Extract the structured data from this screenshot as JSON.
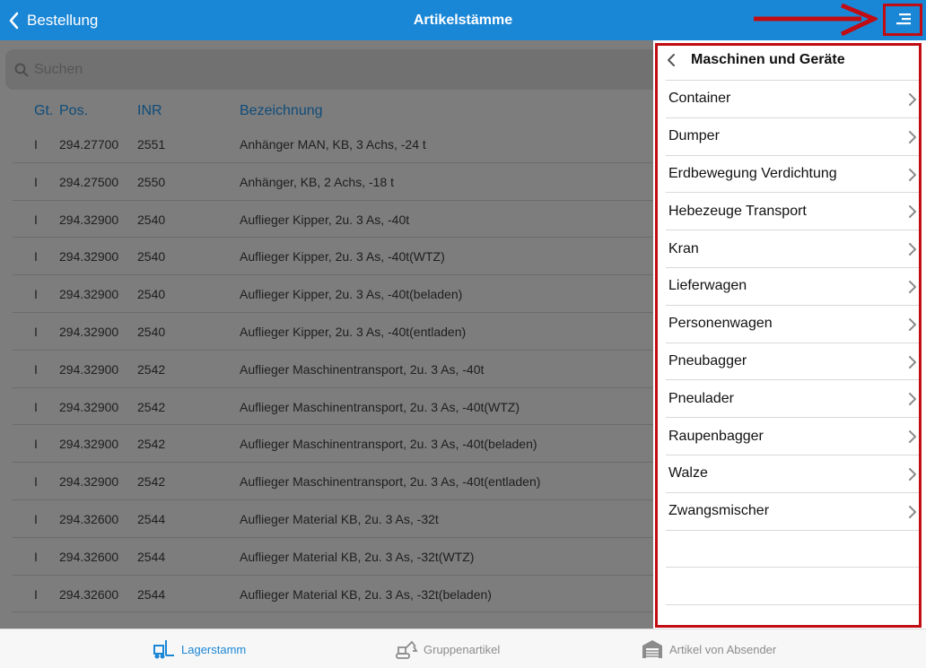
{
  "header": {
    "back_label": "Bestellung",
    "title": "Artikelstämme"
  },
  "search": {
    "placeholder": "Suchen"
  },
  "table": {
    "columns": [
      "Gt.",
      "Pos.",
      "INR",
      "Bezeichnung"
    ],
    "rows": [
      {
        "gt": "I",
        "pos": "294.27700",
        "inr": "2551",
        "bez": "Anhänger MAN, KB, 3 Achs, -24 t"
      },
      {
        "gt": "I",
        "pos": "294.27500",
        "inr": "2550",
        "bez": "Anhänger, KB, 2 Achs, -18 t"
      },
      {
        "gt": "I",
        "pos": "294.32900",
        "inr": "2540",
        "bez": "Auflieger Kipper, 2u. 3 As, -40t"
      },
      {
        "gt": "I",
        "pos": "294.32900",
        "inr": "2540",
        "bez": "Auflieger Kipper, 2u. 3 As, -40t(WTZ)"
      },
      {
        "gt": "I",
        "pos": "294.32900",
        "inr": "2540",
        "bez": "Auflieger Kipper, 2u. 3 As, -40t(beladen)"
      },
      {
        "gt": "I",
        "pos": "294.32900",
        "inr": "2540",
        "bez": "Auflieger Kipper, 2u. 3 As, -40t(entladen)"
      },
      {
        "gt": "I",
        "pos": "294.32900",
        "inr": "2542",
        "bez": "Auflieger Maschinentransport, 2u. 3 As, -40t"
      },
      {
        "gt": "I",
        "pos": "294.32900",
        "inr": "2542",
        "bez": "Auflieger Maschinentransport, 2u. 3 As, -40t(WTZ)"
      },
      {
        "gt": "I",
        "pos": "294.32900",
        "inr": "2542",
        "bez": "Auflieger Maschinentransport, 2u. 3 As, -40t(beladen)"
      },
      {
        "gt": "I",
        "pos": "294.32900",
        "inr": "2542",
        "bez": "Auflieger Maschinentransport, 2u. 3 As, -40t(entladen)"
      },
      {
        "gt": "I",
        "pos": "294.32600",
        "inr": "2544",
        "bez": "Auflieger Material  KB, 2u. 3 As, -32t"
      },
      {
        "gt": "I",
        "pos": "294.32600",
        "inr": "2544",
        "bez": "Auflieger Material  KB, 2u. 3 As, -32t(WTZ)"
      },
      {
        "gt": "I",
        "pos": "294.32600",
        "inr": "2544",
        "bez": "Auflieger Material  KB, 2u. 3 As, -32t(beladen)"
      }
    ]
  },
  "panel": {
    "title": "Maschinen und Geräte",
    "items": [
      "Container",
      "Dumper",
      "Erdbewegung Verdichtung",
      "Hebezeuge Transport",
      "Kran",
      "Lieferwagen",
      "Personenwagen",
      "Pneubagger",
      "Pneulader",
      "Raupenbagger",
      "Walze",
      "Zwangsmischer"
    ]
  },
  "tabs": [
    {
      "label": "Lagerstamm",
      "icon": "forklift-icon",
      "active": true
    },
    {
      "label": "Gruppenartikel",
      "icon": "excavator-icon",
      "active": false
    },
    {
      "label": "Artikel von Absender",
      "icon": "warehouse-icon",
      "active": false
    }
  ],
  "colors": {
    "accent": "#1a87d6",
    "highlight": "#c00c12",
    "dim_overlay": "#7d7d7d"
  }
}
